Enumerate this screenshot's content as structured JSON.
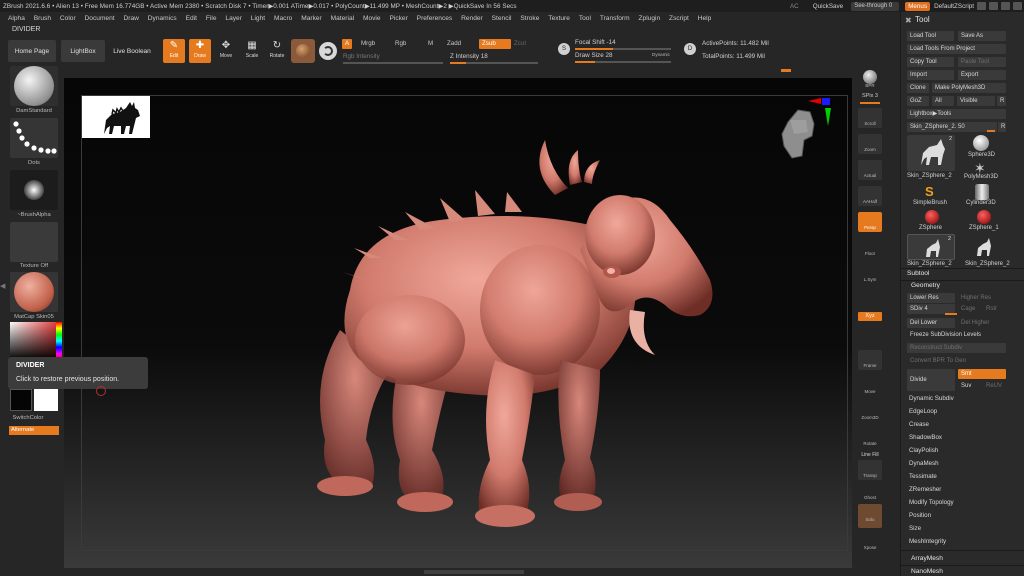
{
  "titlebar": {
    "status": "ZBrush 2021.6.6  • Alien 13  • Free Mem 16.774GB • Active Mem 2380 • Scratch Disk 7 • Timer▶0.001 ATime▶0.017 • PolyCount▶11.499 MP • MeshCount▶2 ▶QuickSave In 56 Secs",
    "ac": "AC",
    "quicksave": "QuickSave",
    "see_through": "See-through  0",
    "menus": "Menus",
    "default_script": "DefaultZScript"
  },
  "menubar": [
    "Alpha",
    "Brush",
    "Color",
    "Document",
    "Draw",
    "Dynamics",
    "Edit",
    "File",
    "Layer",
    "Light",
    "Macro",
    "Marker",
    "Material",
    "Movie",
    "Picker",
    "Preferences",
    "Render",
    "Stencil",
    "Stroke",
    "Texture",
    "Tool",
    "Transform",
    "Zplugin",
    "Zscript",
    "Help"
  ],
  "divider_label": "DIVIDER",
  "toolbar": {
    "home_page": "Home Page",
    "lightbox": "LightBox",
    "live_boolean": "Live Boolean",
    "edit": "Edit",
    "draw": "Draw",
    "move": "Move",
    "scale": "Scale",
    "rotate": "Rotate",
    "a_btn": "A",
    "mrgb": "Mrgb",
    "rgb": "Rgb",
    "m": "M",
    "zadd": "Zadd",
    "zsub": "Zsub",
    "zcut": "Zcut",
    "rgb_intensity": "Rgb Intensity",
    "z_intensity": "Z Intensity 18",
    "focal_shift": "Focal Shift -14",
    "draw_size": "Draw Size 28",
    "dynamic": "Dynamic",
    "active_points": "ActivePoints: 11.482 Mil",
    "total_points": "TotalPoints: 11.499 Mil",
    "s_icon": "S",
    "d_icon": "D"
  },
  "leftshelf": {
    "brush": "DamStandard",
    "stroke": "Dots",
    "alpha": "~BrushAlpha",
    "texture": "Texture Off",
    "material": "MatCap Skin05",
    "switch_color": "SwitchColor",
    "alternate": "Alternate"
  },
  "tooltip": {
    "title": "DIVIDER",
    "body": "Click to restore previous position."
  },
  "rightshelf": [
    "BPR",
    "SPix 3",
    "Scroll",
    "Zoom",
    "Actual",
    "AAHalf",
    "Persp",
    "Floor",
    "L.Sym",
    "Xyz",
    "Frame",
    "Move",
    "Zoom3D",
    "Rotate",
    "Line Fill",
    "Transp",
    "Ghost",
    "Solo",
    "Xpose"
  ],
  "palette": {
    "title": "Tool",
    "load_tool": "Load Tool",
    "save_as": "Save As",
    "load_from_project": "Load Tools From Project",
    "copy_tool": "Copy Tool",
    "paste_tool": "Paste Tool",
    "import": "Import",
    "export": "Export",
    "clone": "Clone",
    "make_polymesh": "Make PolyMesh3D",
    "goz": "GoZ",
    "all": "All",
    "visible": "Visible",
    "r": "R",
    "lightbox_tools": "Lightbox▶Tools",
    "current_tool": "Skin_ZSphere_2. 50",
    "tools": [
      "Skin_ZSphere_2",
      "Sphere3D",
      "PolyMesh3D",
      "SimpleBrush",
      "Cylinder3D",
      "ZSphere",
      "ZSphere_1",
      "Skin_ZSphere_2",
      "Skin_ZSphere_2"
    ],
    "tool_badge": "2",
    "subtool": "Subtool",
    "geometry": "Geometry",
    "lower_res": "Lower Res",
    "higher_res": "Higher Res",
    "sdiv": "SDiv 4",
    "cage": "Cage",
    "rstr": "Rstr",
    "del_lower": "Del Lower",
    "del_higher": "Del Higher",
    "freeze_subdiv": "Freeze SubDivision Levels",
    "reconstruct": "Reconstruct Subdiv",
    "convert_bpr": "Convert BPR To Geo",
    "divide": "Divide",
    "smt": "Smt",
    "suv": "Suv",
    "reuv": "ReUV",
    "items": [
      "Dynamic Subdiv",
      "EdgeLoop",
      "Crease",
      "ShadowBox",
      "ClayPolish",
      "DynaMesh",
      "Tessimate",
      "ZRemesher",
      "Modify Topology",
      "Position",
      "Size",
      "MeshIntegrity"
    ],
    "array_mesh": "ArrayMesh",
    "nano_mesh": "NanoMesh"
  },
  "colors": {
    "accent": "#e57a1f",
    "model": "#d4847a",
    "background": "#262626"
  }
}
